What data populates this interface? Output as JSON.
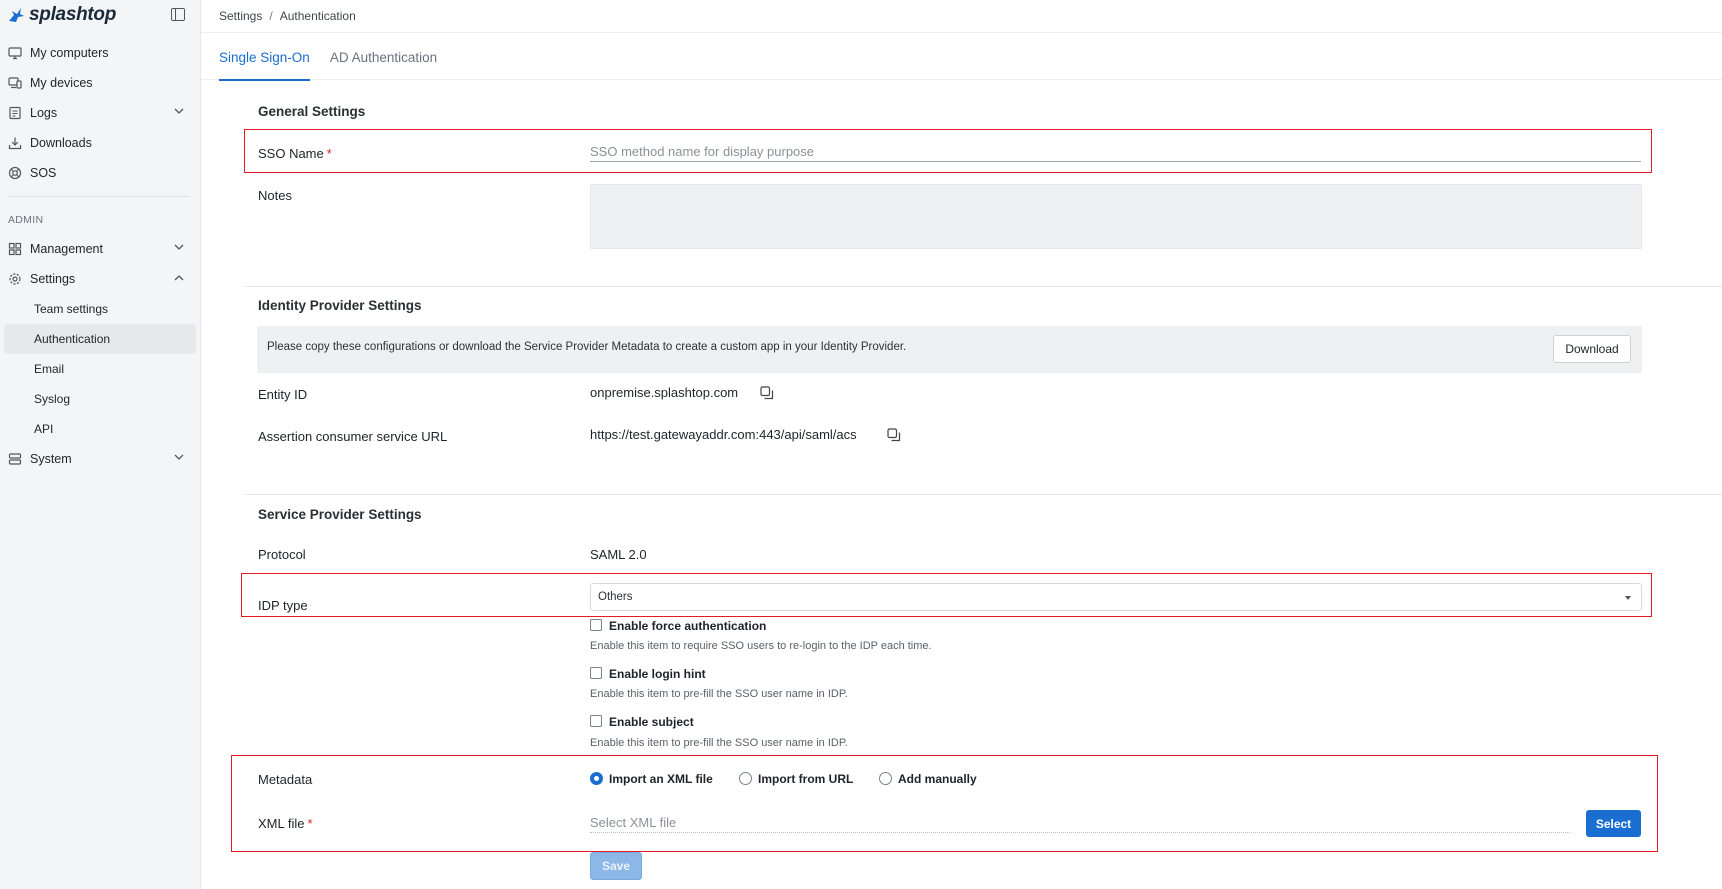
{
  "brand": {
    "name": "splashtop"
  },
  "sidebar": {
    "items": [
      {
        "label": "My computers",
        "icon": "monitor-icon"
      },
      {
        "label": "My devices",
        "icon": "devices-icon"
      },
      {
        "label": "Logs",
        "icon": "logs-icon"
      },
      {
        "label": "Downloads",
        "icon": "download-icon"
      },
      {
        "label": "SOS",
        "icon": "lifebuoy-icon"
      }
    ],
    "admin_label": "ADMIN",
    "admin_items": {
      "management": "Management",
      "settings": "Settings",
      "system": "System"
    },
    "settings_sub": [
      "Team settings",
      "Authentication",
      "Email",
      "Syslog",
      "API"
    ]
  },
  "breadcrumb": {
    "parent": "Settings",
    "separator": "/",
    "current": "Authentication"
  },
  "tabs": [
    {
      "label": "Single Sign-On",
      "active": true
    },
    {
      "label": "AD Authentication",
      "active": false
    }
  ],
  "general": {
    "title": "General Settings",
    "sso_name_label": "SSO Name",
    "required_mark": "*",
    "sso_name_placeholder": "SSO method name for display purpose",
    "notes_label": "Notes"
  },
  "idp": {
    "title": "Identity Provider Settings",
    "info": "Please copy these configurations or download the Service Provider Metadata to create a custom app in your Identity Provider.",
    "download_label": "Download",
    "entity_id_label": "Entity ID",
    "entity_id_value": "onpremise.splashtop.com",
    "acs_label": "Assertion consumer service URL",
    "acs_value": "https://test.gatewayaddr.com:443/api/saml/acs"
  },
  "sp": {
    "title": "Service Provider Settings",
    "protocol_label": "Protocol",
    "protocol_value": "SAML 2.0",
    "idp_type_label": "IDP type",
    "idp_type_value": "Others",
    "options": [
      {
        "label": "Enable force authentication",
        "hint": "Enable this item to require SSO users to re-login to the IDP each time."
      },
      {
        "label": "Enable login hint",
        "hint": "Enable this item to pre-fill the SSO user name in IDP."
      },
      {
        "label": "Enable subject",
        "hint": "Enable this item to pre-fill the SSO user name in IDP."
      }
    ],
    "metadata_label": "Metadata",
    "metadata_options": [
      "Import an XML file",
      "Import from URL",
      "Add manually"
    ],
    "xml_file_label": "XML file",
    "xml_placeholder": "Select XML file",
    "select_label": "Select",
    "save_label": "Save"
  },
  "colors": {
    "accent": "#1a6ed2",
    "highlight": "#e41b23"
  }
}
